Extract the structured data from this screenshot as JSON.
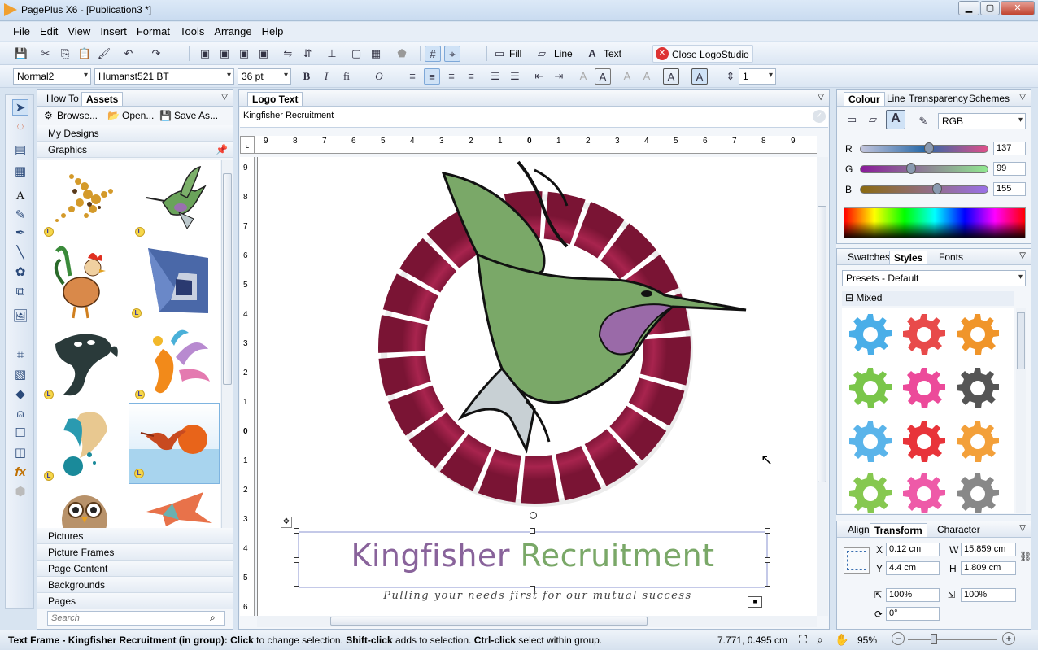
{
  "window": {
    "title": "PagePlus X6 - [Publication3 *]"
  },
  "menu": [
    "File",
    "Edit",
    "View",
    "Insert",
    "Format",
    "Tools",
    "Arrange",
    "Help"
  ],
  "toolbar1": {
    "fill_label": "Fill",
    "line_label": "Line",
    "text_label": "Text",
    "close_logostudio_label": "Close LogoStudio"
  },
  "toolbar2": {
    "style_value": "Normal2",
    "font_value": "Humanst521 BT",
    "size_value": "36 pt",
    "spacing_value": "1"
  },
  "left_panel": {
    "tabs": [
      "How To",
      "Assets"
    ],
    "browse_label": "Browse...",
    "open_label": "Open...",
    "save_as_label": "Save As...",
    "categories_top": [
      "My Designs",
      "Graphics"
    ],
    "categories_bottom": [
      "Pictures",
      "Picture Frames",
      "Page Content",
      "Backgrounds",
      "Pages"
    ],
    "search_placeholder": "Search"
  },
  "doc": {
    "panel_title": "Logo Text",
    "logo_text_value": "Kingfisher Recruitment",
    "heading_word1": "Kingfisher",
    "heading_word2": "Recruitment",
    "tagline": "Pulling your needs first for our mutual success",
    "ruler_h_labels": [
      "9",
      "8",
      "7",
      "6",
      "5",
      "4",
      "3",
      "2",
      "1",
      "0",
      "1",
      "2",
      "3",
      "4",
      "5",
      "6",
      "7",
      "8",
      "9"
    ],
    "ruler_v_labels": [
      "9",
      "8",
      "7",
      "6",
      "5",
      "4",
      "3",
      "2",
      "1",
      "0",
      "1",
      "2",
      "3",
      "4",
      "5",
      "6"
    ]
  },
  "colour_panel": {
    "tabs": [
      "Colour",
      "Line",
      "Transparency",
      "Schemes"
    ],
    "model": "RGB",
    "r_label": "R",
    "g_label": "G",
    "b_label": "B",
    "r": 137,
    "g": 99,
    "b": 155
  },
  "styles_panel": {
    "tabs": [
      "Swatches",
      "Styles",
      "Fonts"
    ],
    "preset": "Presets - Default",
    "group": "Mixed"
  },
  "transform_panel": {
    "tabs": [
      "Align",
      "Transform",
      "Character"
    ],
    "x_label": "X",
    "x": "0.12 cm",
    "y_label": "Y",
    "y": "4.4 cm",
    "w_label": "W",
    "w": "15.859 cm",
    "h_label": "H",
    "h": "1.809 cm",
    "scale_x": "100%",
    "scale_y": "100%",
    "rotation": "0°"
  },
  "status": {
    "frame": "Text Frame - Kingfisher Recruitment (in group):",
    "click": "Click",
    "click_desc": "to change selection.",
    "shift": "Shift-click",
    "shift_desc": "adds to selection.",
    "ctrl": "Ctrl-click",
    "ctrl_desc": "select within group.",
    "coords": "7.771, 0.495 cm",
    "zoom": "95%"
  },
  "colors": {
    "purple": "#89639b",
    "green": "#7aa868",
    "crimson": "#9b1f47",
    "accent": "#3a6fb0"
  }
}
